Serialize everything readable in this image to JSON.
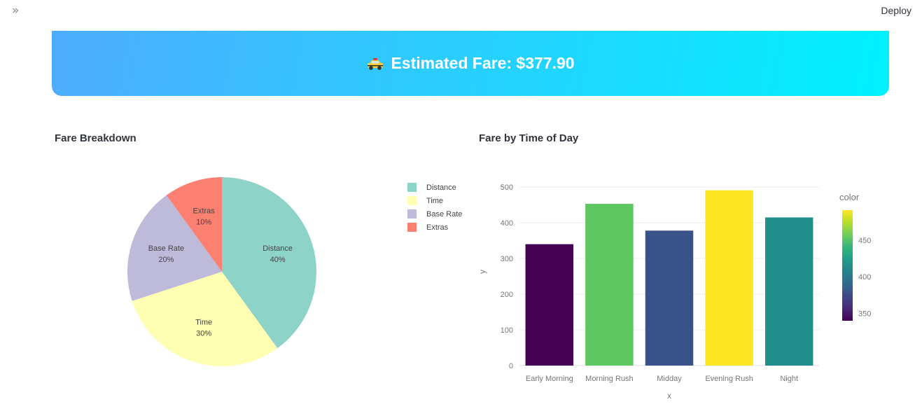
{
  "header": {
    "expand_icon": "double-chevron-right-icon",
    "deploy_label": "Deploy"
  },
  "banner": {
    "icon": "taxi-icon",
    "text": "Estimated Fare: $377.90",
    "gradient": [
      "#4facfe",
      "#00f2fe"
    ]
  },
  "pie_section": {
    "title": "Fare Breakdown"
  },
  "bar_section": {
    "title": "Fare by Time of Day"
  },
  "chart_data": [
    {
      "type": "pie",
      "labels": [
        "Distance",
        "Time",
        "Base Rate",
        "Extras"
      ],
      "values": [
        40,
        30,
        20,
        10
      ],
      "text": [
        "40%",
        "30%",
        "20%",
        "10%"
      ],
      "colors": [
        "#8dd3c7",
        "#ffffb3",
        "#bebada",
        "#fb8072"
      ],
      "legend": "right"
    },
    {
      "type": "bar",
      "categories": [
        "Early Morning",
        "Morning Rush",
        "Midday",
        "Evening Rush",
        "Night"
      ],
      "values": [
        340,
        453,
        378,
        491,
        415
      ],
      "xlabel": "x",
      "ylabel": "y",
      "ylim": [
        0,
        510
      ],
      "yticks": [
        0,
        100,
        200,
        300,
        400,
        500
      ],
      "grid": true,
      "colorbar": {
        "title": "color",
        "ticks": [
          350,
          400,
          450
        ],
        "range": [
          340,
          491
        ],
        "colorscale": "viridis"
      }
    }
  ]
}
